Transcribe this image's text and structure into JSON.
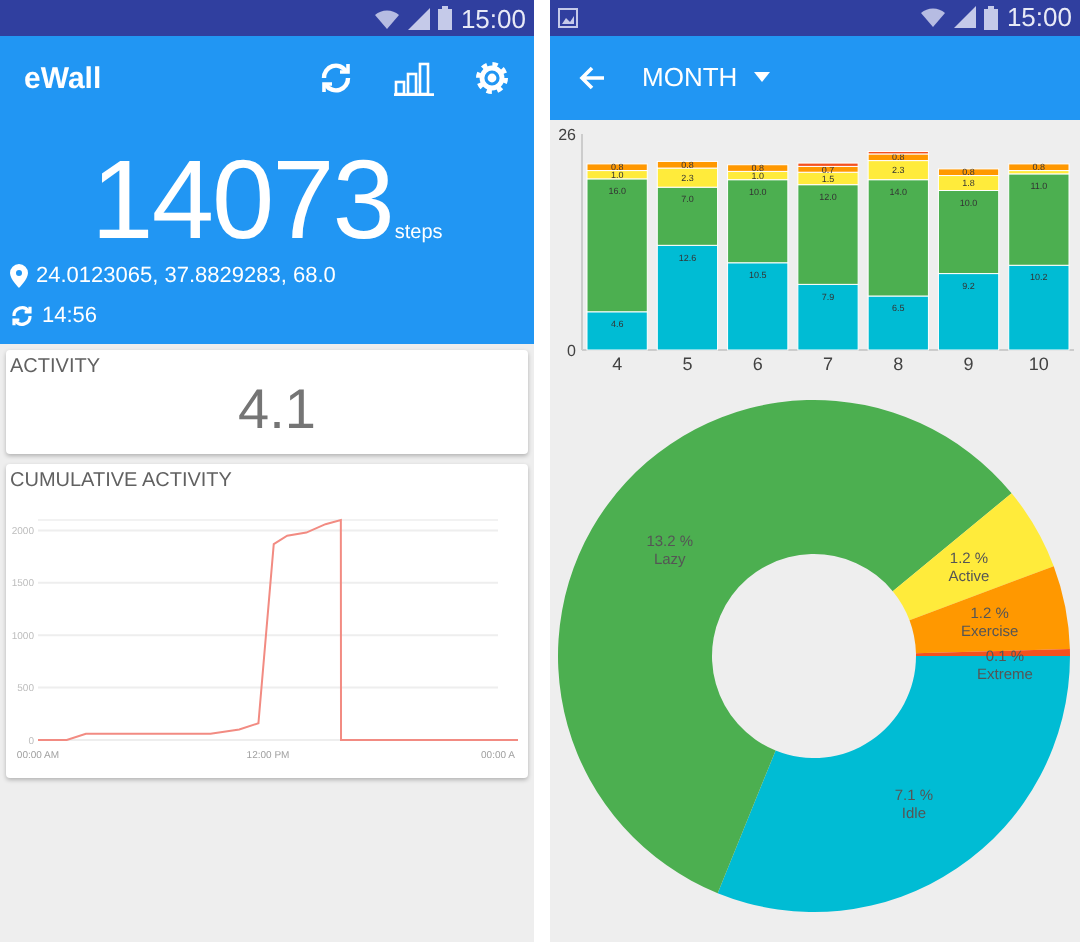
{
  "left_screen": {
    "status_bar": {
      "time": "15:00"
    },
    "app_bar": {
      "title": "eWall"
    },
    "steps": {
      "value": "14073",
      "unit": "steps"
    },
    "location": "24.0123065, 37.8829283, 68.0",
    "last_sync": "14:56",
    "activity_card": {
      "title": "ACTIVITY",
      "value": "4.1"
    },
    "cumulative_card": {
      "title": "CUMULATIVE ACTIVITY",
      "chart_data": {
        "type": "line",
        "x": [
          0,
          1.5,
          2.5,
          9,
          10.5,
          11.5,
          12.3,
          13,
          14,
          15,
          15.8,
          15.81,
          24
        ],
        "series": [
          {
            "color": "#f28b82",
            "values": [
              0,
              0,
              60,
              60,
              100,
              160,
              1870,
              1950,
              1980,
              2060,
              2100,
              0,
              0
            ]
          }
        ],
        "xlim": [
          0,
          24
        ],
        "ylim": [
          0,
          2100
        ],
        "grid": true,
        "yticks": [
          0,
          500,
          1000,
          1500,
          2000
        ],
        "xticks": [
          {
            "value": 0,
            "label": "00:00 AM"
          },
          {
            "value": 12,
            "label": "12:00 PM"
          },
          {
            "value": 24,
            "label": "00:00 A"
          }
        ]
      }
    }
  },
  "right_screen": {
    "status_bar": {
      "time": "15:00"
    },
    "app_bar": {
      "period": "MONTH"
    },
    "bar_chart": {
      "chart_data": {
        "type": "bar",
        "stacked": true,
        "categories": [
          "4",
          "5",
          "6",
          "7",
          "8",
          "9",
          "10"
        ],
        "series": [
          {
            "color": "#00bcd4",
            "values": [
              4.6,
              12.6,
              10.5,
              7.9,
              6.5,
              9.2,
              10.2
            ],
            "value_labels": [
              "4.6",
              "12.6",
              "10.5",
              "7.9",
              "6.5",
              "9.2",
              "10.2"
            ]
          },
          {
            "color": "#4caf50",
            "values": [
              16.0,
              7.0,
              10.0,
              12.0,
              14.0,
              10.0,
              11.0
            ],
            "value_labels": [
              "16.0",
              "7.0",
              "10.0",
              "12.0",
              "14.0",
              "10.0",
              "11.0"
            ]
          },
          {
            "color": "#ffeb3b",
            "values": [
              1.0,
              2.3,
              1.0,
              1.5,
              2.3,
              1.8,
              0.4
            ],
            "value_labels": [
              "1.0",
              "2.3",
              "1.0",
              "1.5",
              "2.3",
              "1.8",
              null
            ]
          },
          {
            "color": "#ff9800",
            "values": [
              0.8,
              0.8,
              0.8,
              0.7,
              0.8,
              0.8,
              0.8
            ],
            "value_labels": [
              "0.8",
              "0.8",
              "0.8",
              "0.7",
              "0.8",
              "0.8",
              "0.8"
            ]
          },
          {
            "color": "#f4511e",
            "values": [
              0,
              0,
              0,
              0.4,
              0.3,
              0,
              0
            ]
          }
        ],
        "ylim": [
          0,
          26
        ],
        "yticks": [
          0,
          26
        ]
      }
    },
    "donut": {
      "chart_data": {
        "type": "donut",
        "categories": [
          "Idle",
          "Lazy",
          "Active",
          "Exercise",
          "Extreme"
        ],
        "values": [
          7.1,
          13.2,
          1.2,
          1.2,
          0.1
        ],
        "colors": [
          "#00bcd4",
          "#4caf50",
          "#ffeb3b",
          "#ff9800",
          "#f4511e"
        ],
        "value_labels": [
          "7.1 %",
          "13.2 %",
          "1.2 %",
          "1.2 %",
          "0.1 %"
        ]
      }
    }
  }
}
